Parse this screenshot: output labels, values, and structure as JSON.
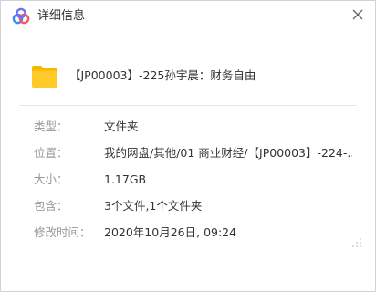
{
  "window": {
    "title": "详细信息",
    "logo_icon": "baidu-netdisk-cloud-icon",
    "close_icon": "close-icon"
  },
  "file": {
    "icon": "folder-icon",
    "icon_color": "#ffca28",
    "name": "【JP00003】-225孙宇晨：财务自由"
  },
  "properties": [
    {
      "label": "类型：",
      "value": "文件夹"
    },
    {
      "label": "位置：",
      "value": "我的网盘/其他/01 商业财经/【JP00003】-224-..."
    },
    {
      "label": "大小：",
      "value": "1.17GB"
    },
    {
      "label": "包含：",
      "value": "3个文件,1个文件夹"
    },
    {
      "label": "修改时间：",
      "value": "2020年10月26日, 09:24"
    }
  ],
  "colors": {
    "label_gray": "#999999",
    "text_dark": "#333333",
    "logo_blue": "#3b8cf5",
    "logo_red": "#f05c5c",
    "logo_purple": "#7a6cf0"
  }
}
